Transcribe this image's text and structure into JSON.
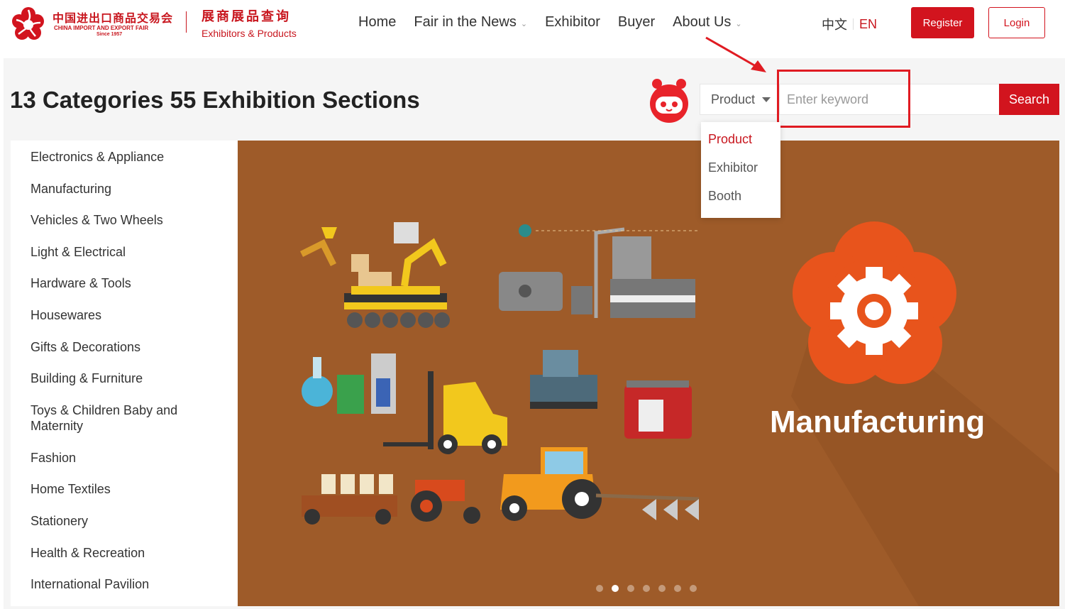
{
  "header": {
    "logo_cn": "中国进出口商品交易会",
    "logo_en": "CHINA IMPORT AND EXPORT FAIR",
    "logo_since": "Since 1957",
    "subtitle_cn": "展商展品查询",
    "subtitle_en": "Exhibitors & Products",
    "nav": [
      {
        "label": "Home",
        "has_dropdown": false
      },
      {
        "label": "Fair in the News",
        "has_dropdown": true
      },
      {
        "label": "Exhibitor",
        "has_dropdown": false
      },
      {
        "label": "Buyer",
        "has_dropdown": false
      },
      {
        "label": "About Us",
        "has_dropdown": true
      }
    ],
    "lang_cn": "中文",
    "lang_en": "EN",
    "register_label": "Register",
    "login_label": "Login"
  },
  "page_title": "13 Categories 55 Exhibition Sections",
  "search": {
    "type_selected": "Product",
    "placeholder": "Enter keyword",
    "value": "",
    "button_label": "Search",
    "dropdown_options": [
      "Product",
      "Exhibitor",
      "Booth"
    ]
  },
  "categories": [
    "Electronics & Appliance",
    "Manufacturing",
    "Vehicles & Two Wheels",
    "Light & Electrical",
    "Hardware & Tools",
    "Housewares",
    "Gifts & Decorations",
    "Building & Furniture",
    "Toys & Children Baby and Maternity",
    "Fashion",
    "Home Textiles",
    "Stationery",
    "Health & Recreation",
    "International Pavilion"
  ],
  "banner": {
    "title": "Manufacturing",
    "icon": "gear-icon",
    "slide_count": 7,
    "active_slide": 2
  },
  "colors": {
    "brand_red": "#d2141e",
    "banner_bg": "#9e5b29",
    "badge_orange": "#e8541c"
  }
}
